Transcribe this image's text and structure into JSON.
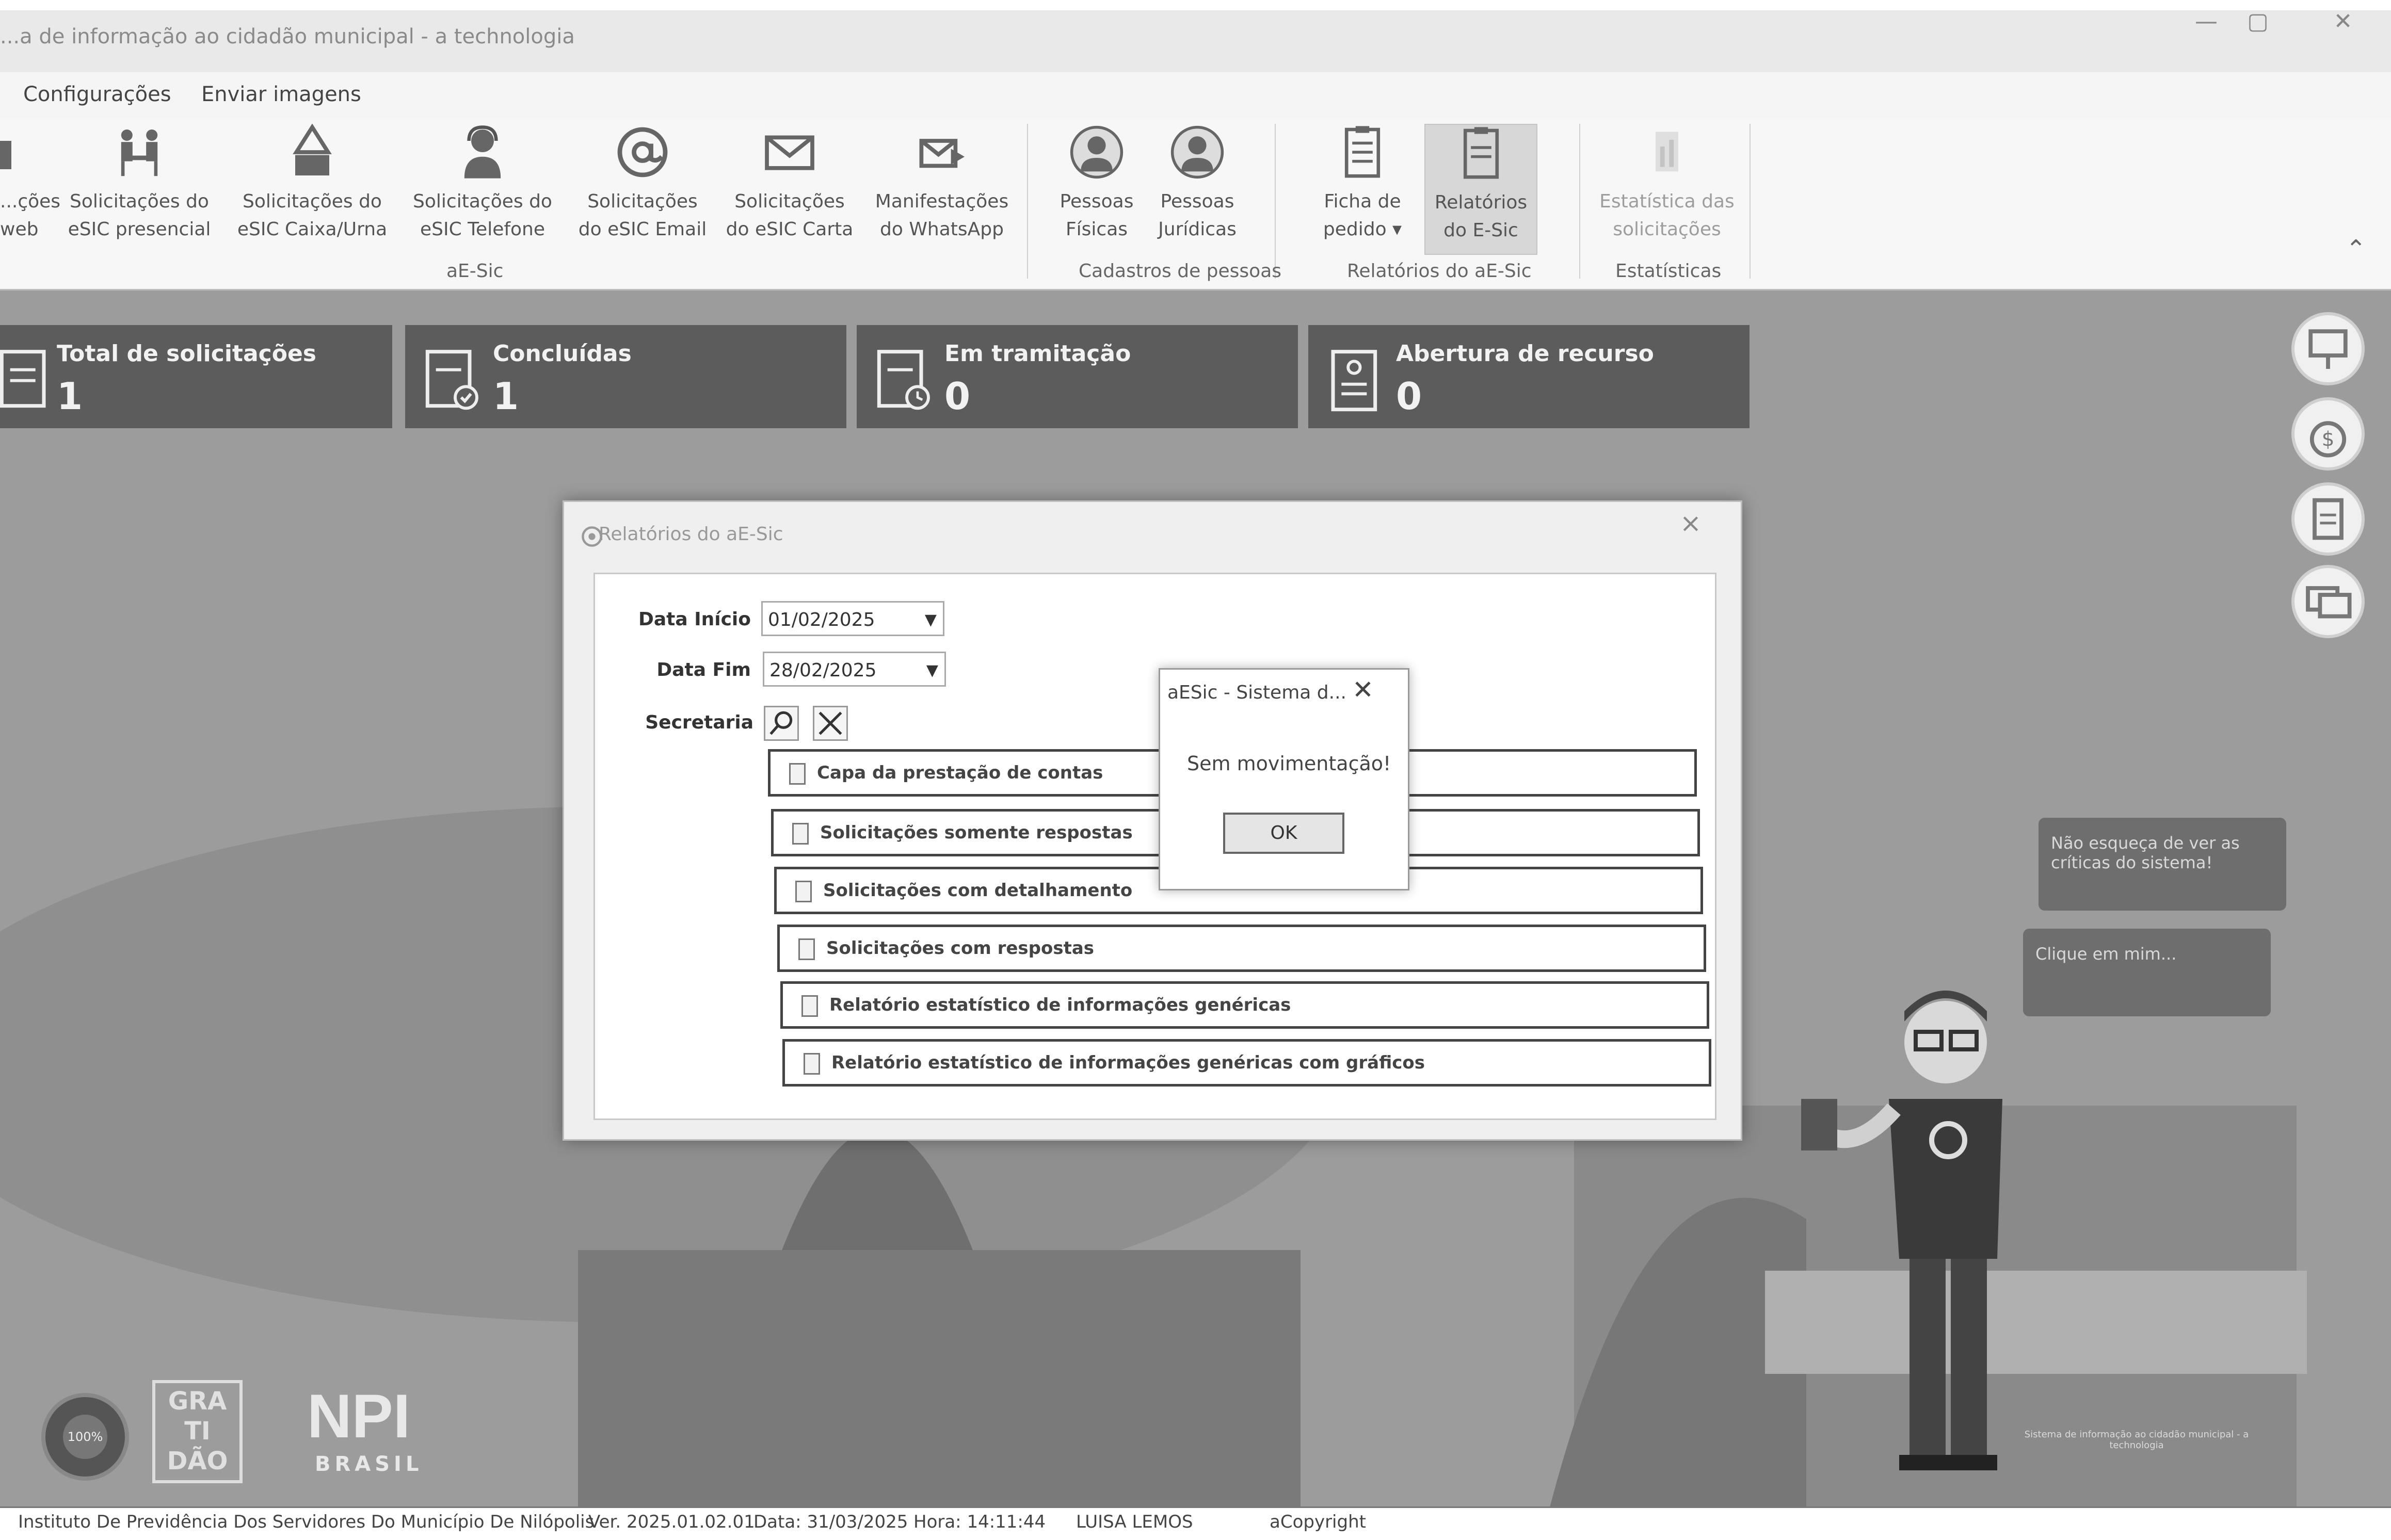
{
  "window": {
    "title": "...a de informação ao cidadão municipal - a technologia",
    "controls": [
      "—",
      "▢",
      "✕"
    ]
  },
  "menu": {
    "items": [
      "Configurações",
      "Enviar imagens"
    ]
  },
  "ribbon": {
    "buttons": [
      {
        "label": "...ções\nweb",
        "icon": "web-requests-icon"
      },
      {
        "label": "Solicitações do\neSIC presencial",
        "icon": "people-meeting-icon"
      },
      {
        "label": "Solicitações do\neSIC Caixa/Urna",
        "icon": "ballot-box-icon"
      },
      {
        "label": "Solicitações do\neSIC Telefone",
        "icon": "telephone-operator-icon"
      },
      {
        "label": "Solicitações\ndo eSIC Email",
        "icon": "at-sign-icon"
      },
      {
        "label": "Solicitações\ndo eSIC Carta",
        "icon": "envelope-icon"
      },
      {
        "label": "Manifestações\ndo WhatsApp",
        "icon": "whatsapp-message-icon"
      },
      {
        "label": "Pessoas\nFísicas",
        "icon": "person-icon"
      },
      {
        "label": "Pessoas\nJurídicas",
        "icon": "company-person-icon"
      },
      {
        "label": "Ficha de\npedido ▾",
        "icon": "request-form-icon"
      },
      {
        "label": "Relatórios\ndo E-Sic",
        "icon": "report-document-icon"
      },
      {
        "label": "Estatística das\nsolicitações",
        "icon": "statistics-icon"
      }
    ],
    "groups": [
      "aE-Sic",
      "Cadastros de pessoas",
      "Relatórios do aE-Sic",
      "Estatísticas"
    ],
    "collapse_glyph": "⌃"
  },
  "tiles": [
    {
      "label": "Total de solicitações",
      "value": "1"
    },
    {
      "label": "Concluídas",
      "value": "1"
    },
    {
      "label": "Em tramitação",
      "value": "0"
    },
    {
      "label": "Abertura de recurso",
      "value": "0"
    }
  ],
  "reports_dialog": {
    "title": "Relatórios do aE-Sic",
    "close": "×",
    "start_label": "Data Início",
    "start_value": "01/02/2025",
    "end_label": "Data Fim",
    "end_value": "28/02/2025",
    "secretaria_label": "Secretaria",
    "reports": [
      "Capa da prestação de contas",
      "Solicitações somente respostas",
      "Solicitações com detalhamento",
      "Solicitações com respostas",
      "Relatório estatístico de informações genéricas",
      "Relatório estatístico de informações genéricas com gráficos"
    ]
  },
  "message_box": {
    "title": "aESic - Sistema d...",
    "close": "✕",
    "message": "Sem movimentação!",
    "ok": "OK"
  },
  "bubbles": [
    "Não esqueça de ver as críticas do sistema!",
    "Clique em mim..."
  ],
  "logos": {
    "seal_text": "100%",
    "gratidao": "GRA TI DÃO",
    "npi": "NPI",
    "npi_sub": "BRASIL",
    "bottom_caption": "Sistema de informação ao cidadão municipal - a technologia"
  },
  "status": {
    "institution": "Instituto De Previdência Dos Servidores Do Município De Nilópolis",
    "version": "Ver. 2025.01.02.01",
    "date": "Data: 31/03/2025",
    "time": "Hora: 14:11:44",
    "user": "LUISA LEMOS",
    "copyright": "aCopyright"
  }
}
